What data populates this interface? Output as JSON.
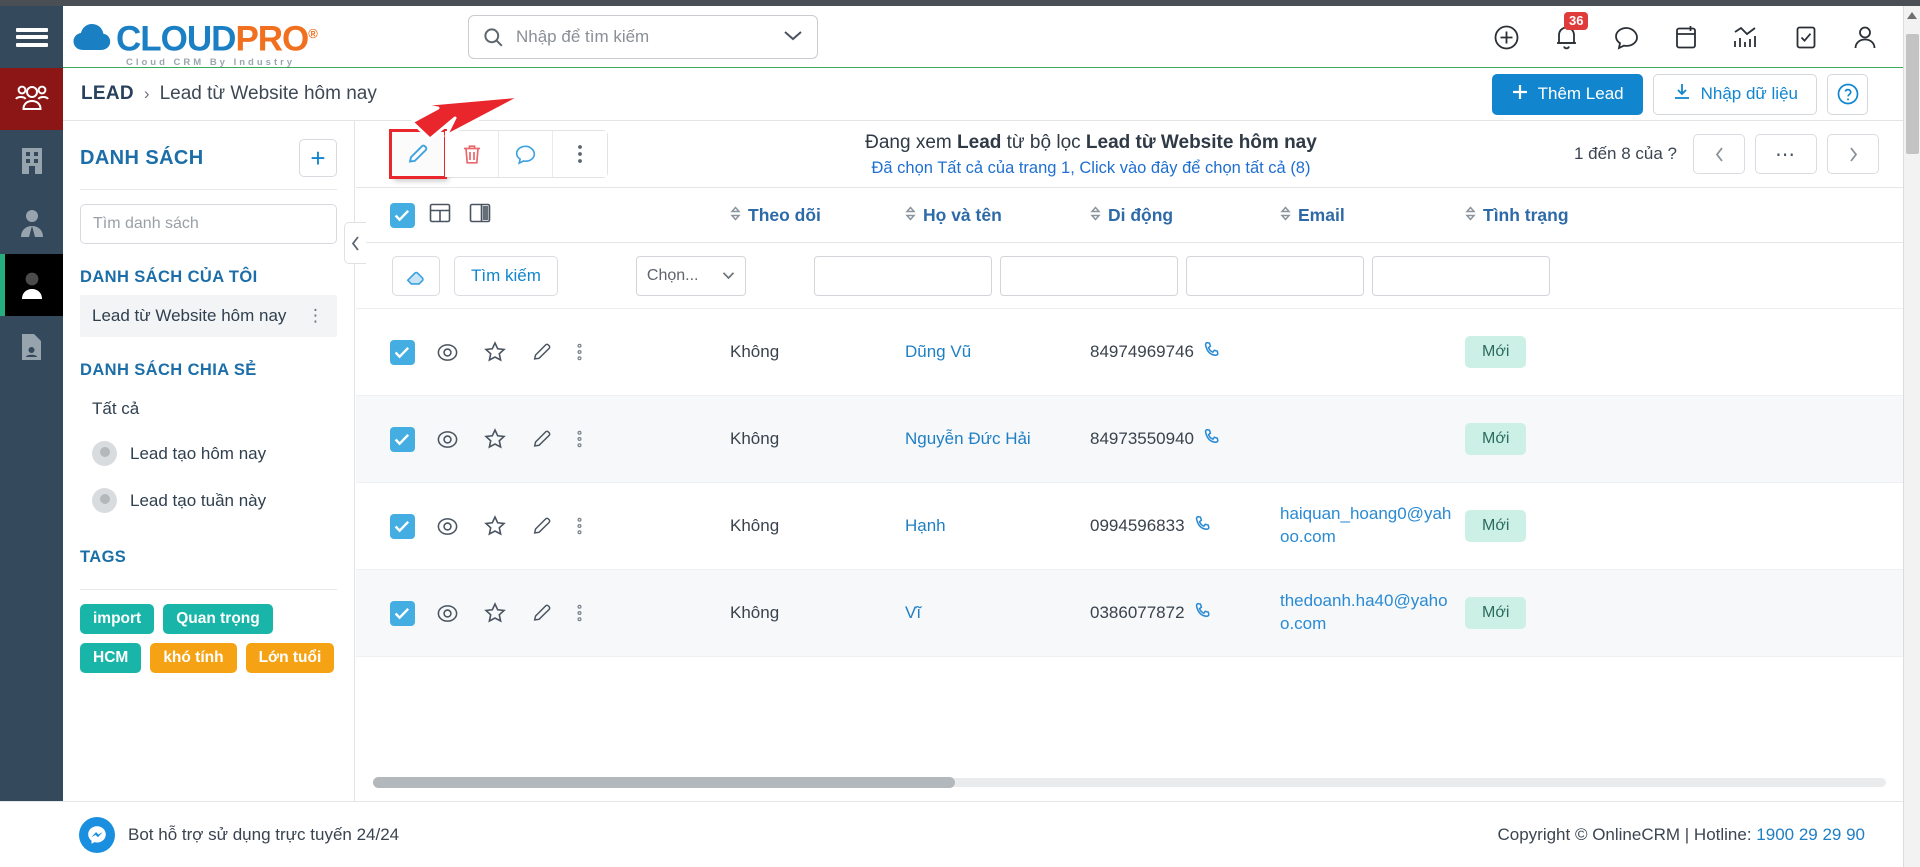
{
  "brand": {
    "name_part1": "CLOUD",
    "name_part2": "PRO",
    "reg": "®",
    "tagline": "Cloud CRM By Industry"
  },
  "header": {
    "search_placeholder": "Nhập để tìm kiếm",
    "search_value": "",
    "notification_count": "36",
    "icons": [
      "plus-circle-icon",
      "bell-icon",
      "chat-icon",
      "calendar-icon",
      "analytics-icon",
      "task-icon",
      "user-account-icon"
    ]
  },
  "breadcrumb": {
    "root": "LEAD",
    "separator": "›",
    "leaf": "Lead từ Website hôm nay"
  },
  "actions": {
    "add_lead": "Thêm Lead",
    "add_lead_icon": "plus-icon",
    "import": "Nhập dữ liệu",
    "import_icon": "download-icon",
    "help": "?"
  },
  "sidebar": {
    "title": "DANH SÁCH",
    "add_button": "+",
    "search_placeholder": "Tìm danh sách",
    "search_value": "",
    "my_lists_label": "DANH SÁCH CỦA TÔI",
    "my_lists": [
      {
        "label": "Lead từ Website hôm nay",
        "menu": "⋮",
        "selected": true
      }
    ],
    "shared_lists_label": "DANH SÁCH CHIA SẺ",
    "shared_lists": [
      {
        "label": "Tất cả",
        "avatar": false
      },
      {
        "label": "Lead tạo hôm nay",
        "avatar": true
      },
      {
        "label": "Lead tạo tuần này",
        "avatar": true
      }
    ],
    "tags_label": "TAGS",
    "tags": [
      {
        "label": "import",
        "color": "teal"
      },
      {
        "label": "Quan trọng",
        "color": "teal"
      },
      {
        "label": "HCM",
        "color": "teal"
      },
      {
        "label": "khó tính",
        "color": "orange"
      },
      {
        "label": "Lớn tuổi",
        "color": "orange"
      }
    ]
  },
  "toolbar": {
    "edit_icon": "pencil-icon",
    "delete_icon": "trash-icon",
    "comment_icon": "chat-icon",
    "more_icon": "kebab-menu-icon"
  },
  "viewinfo": {
    "line1_prefix": "Đang xem ",
    "line1_bold1": "Lead",
    "line1_mid": " từ bộ lọc ",
    "line1_bold2": "Lead từ Website hôm nay",
    "line2": "Đã chọn Tất cả của trang 1, Click vào đây để chọn tất cả (8)"
  },
  "pager": {
    "range_text": "1 đến 8 của ?",
    "prev": "‹",
    "more": "⋯",
    "next": "›"
  },
  "table": {
    "grid_icon": "grid-view-icon",
    "split_icon": "split-view-icon",
    "columns": [
      {
        "label": "Theo dõi",
        "key": "follow"
      },
      {
        "label": "Họ và tên",
        "key": "name"
      },
      {
        "label": "Di động",
        "key": "mobile"
      },
      {
        "label": "Email",
        "key": "email"
      },
      {
        "label": "Tình trạng",
        "key": "status"
      }
    ],
    "filter": {
      "erase_icon": "eraser-icon",
      "search_label": "Tìm kiếm",
      "select_value": "Chọn...",
      "name_value": "",
      "mobile_value": "",
      "email_value": "",
      "status_value": ""
    },
    "rows": [
      {
        "checked": true,
        "follow": "Không",
        "name": "Dũng Vũ",
        "mobile": "84974969746",
        "email": "",
        "status": "Mới",
        "alt": false
      },
      {
        "checked": true,
        "follow": "Không",
        "name": "Nguyễn Đức Hải",
        "mobile": "84973550940",
        "email": "",
        "status": "Mới",
        "alt": true
      },
      {
        "checked": true,
        "follow": "Không",
        "name": "Hạnh",
        "mobile": "0994596833",
        "email": "haiquan_hoang0@yahoo.com",
        "status": "Mới",
        "alt": false
      },
      {
        "checked": true,
        "follow": "Không",
        "name": "Vĩ",
        "mobile": "0386077872",
        "email": "thedoanh.ha40@yahoo.com",
        "status": "Mới",
        "alt": true
      }
    ]
  },
  "footer": {
    "bot_text": "Bot hỗ trợ sử dụng trực tuyến 24/24",
    "copyright": "Copyright © OnlineCRM | Hotline: ",
    "hotline": "1900 29 29 90"
  },
  "colors": {
    "brand_blue": "#1b7fc4",
    "brand_orange": "#f07020",
    "accent": "#1186ce",
    "rail": "#34495b",
    "rail_active_red": "#8c1616",
    "annotation_red": "#e8262b",
    "green_underline": "#3aaa5e",
    "tag_teal": "#19b5a8",
    "tag_orange": "#f5a314",
    "status_pill": "#cdf0e6"
  }
}
